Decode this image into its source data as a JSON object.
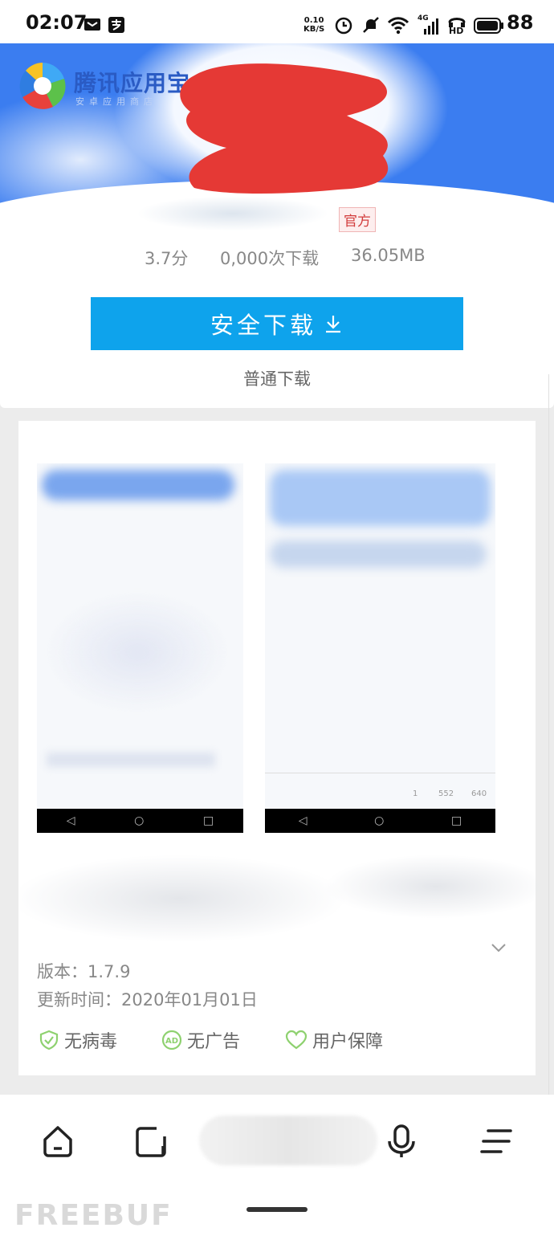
{
  "status_bar": {
    "time": "02:07",
    "net_speed_value": "0.10",
    "net_speed_unit": "KB/S",
    "signal_type": "4G",
    "hd_label": "HD",
    "battery": "88"
  },
  "header": {
    "brand_name": "腾讯应用宝",
    "brand_subtitle": "安卓应用商店",
    "official_badge": "官方",
    "rating": "3.7分",
    "downloads": "0,000次下载",
    "size": "36.05MB"
  },
  "actions": {
    "safe_download": "安全下载",
    "normal_download": "普通下载"
  },
  "details": {
    "version": "版本：1.7.9",
    "update_time": "更新时间：2020年01月01日",
    "badges": [
      "无病毒",
      "无广告",
      "用户保障"
    ]
  },
  "screenshot2": {
    "small_numbers": [
      "1",
      "552",
      "640"
    ]
  },
  "watermark": "FREEBUF",
  "colors": {
    "accent": "#0ea3ec",
    "header_blue": "#3b7df0",
    "badge_green": "#8ed16f",
    "official_red": "#d23c3c"
  }
}
